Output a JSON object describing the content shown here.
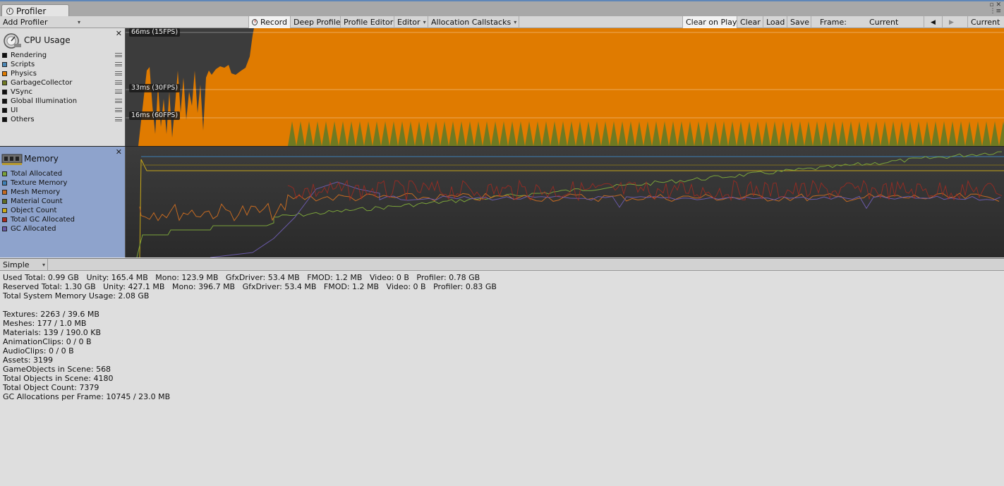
{
  "window": {
    "tab_title": "Profiler"
  },
  "toolbar": {
    "add_profiler": "Add Profiler",
    "record": "Record",
    "deep_profile": "Deep Profile",
    "profile_editor": "Profile Editor",
    "editor": "Editor",
    "allocation_callstacks": "Allocation Callstacks",
    "clear_on_play": "Clear on Play",
    "clear": "Clear",
    "load": "Load",
    "save": "Save",
    "frame_label": "Frame:",
    "frame_value": "Current",
    "current": "Current"
  },
  "cpu_module": {
    "title": "CPU Usage",
    "legend": [
      {
        "label": "Rendering",
        "color": "#111111"
      },
      {
        "label": "Scripts",
        "color": "#4a86b4"
      },
      {
        "label": "Physics",
        "color": "#e07b00"
      },
      {
        "label": "GarbageCollector",
        "color": "#6f7a22"
      },
      {
        "label": "VSync",
        "color": "#111111"
      },
      {
        "label": "Global Illumination",
        "color": "#111111"
      },
      {
        "label": "UI",
        "color": "#111111"
      },
      {
        "label": "Others",
        "color": "#111111"
      }
    ],
    "fps_markers": [
      "66ms (15FPS)",
      "33ms (30FPS)",
      "16ms (60FPS)"
    ]
  },
  "memory_module": {
    "title": "Memory",
    "legend": [
      {
        "label": "Total Allocated",
        "color": "#7aa23a"
      },
      {
        "label": "Texture Memory",
        "color": "#3d7fb5"
      },
      {
        "label": "Mesh Memory",
        "color": "#c46a22"
      },
      {
        "label": "Material Count",
        "color": "#5e6b22"
      },
      {
        "label": "Object Count",
        "color": "#c8a818"
      },
      {
        "label": "Total GC Allocated",
        "color": "#a82a20"
      },
      {
        "label": "GC Allocated",
        "color": "#6a5aa8"
      }
    ]
  },
  "detail": {
    "view_mode": "Simple",
    "lines": [
      "Used Total: 0.99 GB   Unity: 165.4 MB   Mono: 123.9 MB   GfxDriver: 53.4 MB   FMOD: 1.2 MB   Video: 0 B   Profiler: 0.78 GB",
      "Reserved Total: 1.30 GB   Unity: 427.1 MB   Mono: 396.7 MB   GfxDriver: 53.4 MB   FMOD: 1.2 MB   Video: 0 B   Profiler: 0.83 GB",
      "Total System Memory Usage: 2.08 GB",
      "",
      "Textures: 2263 / 39.6 MB",
      "Meshes: 177 / 1.0 MB",
      "Materials: 139 / 190.0 KB",
      "AnimationClips: 0 / 0 B",
      "AudioClips: 0 / 0 B",
      "Assets: 3199",
      "GameObjects in Scene: 568",
      "Total Objects in Scene: 4180",
      "Total Object Count: 7379",
      "GC Allocations per Frame: 10745 / 23.0 MB"
    ]
  }
}
